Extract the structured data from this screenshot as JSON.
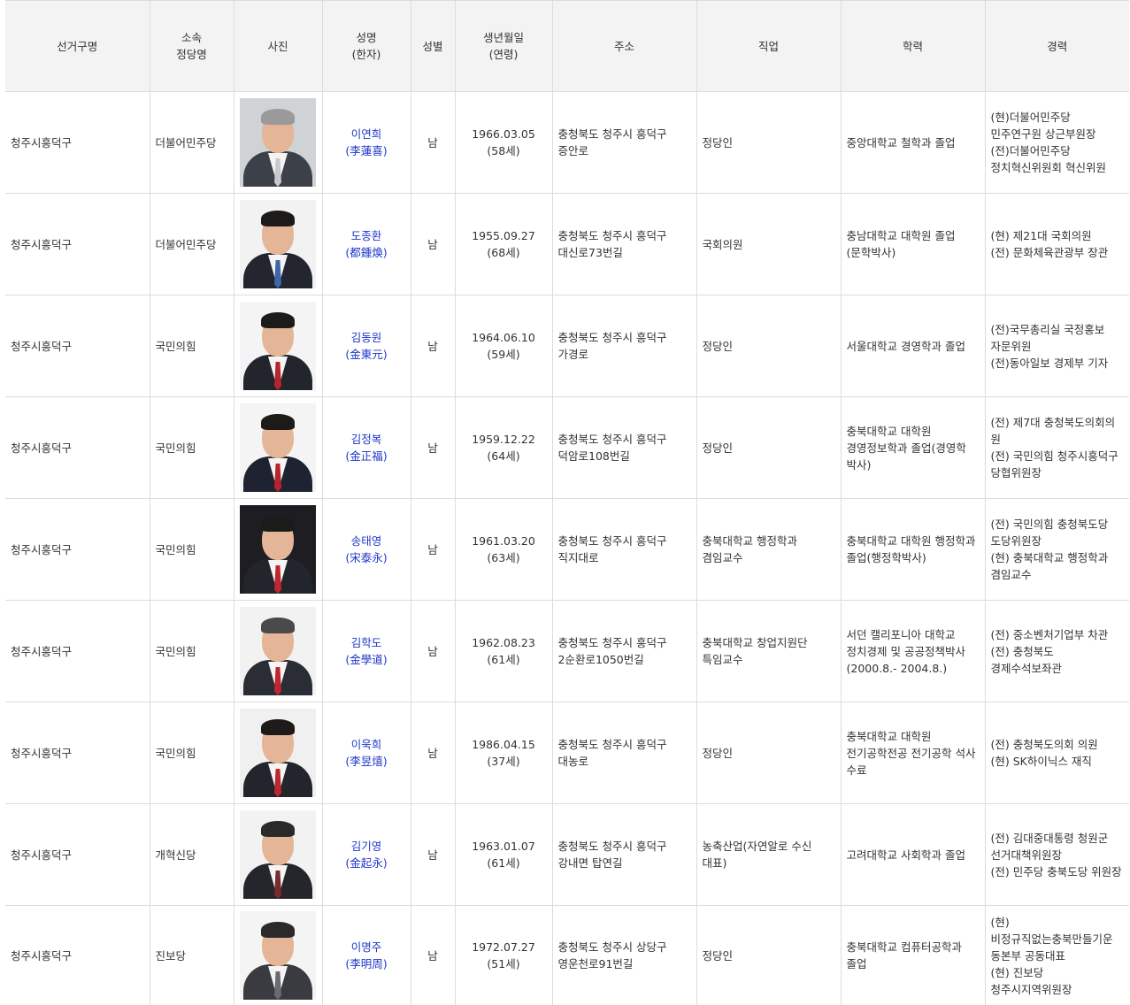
{
  "headers": [
    {
      "line1": "선거구명",
      "line2": ""
    },
    {
      "line1": "소속",
      "line2": "정당명"
    },
    {
      "line1": "사진",
      "line2": ""
    },
    {
      "line1": "성명",
      "line2": "(한자)"
    },
    {
      "line1": "성별",
      "line2": ""
    },
    {
      "line1": "생년월일",
      "line2": "(연령)"
    },
    {
      "line1": "주소",
      "line2": ""
    },
    {
      "line1": "직업",
      "line2": ""
    },
    {
      "line1": "학력",
      "line2": ""
    },
    {
      "line1": "경력",
      "line2": ""
    }
  ],
  "rows": [
    {
      "district": "청주시흥덕구",
      "party": "더불어민주당",
      "name": "이연희",
      "hanja": "(李蓮喜)",
      "gender": "남",
      "birth": "1966.03.05",
      "age": "(58세)",
      "address": "충청북도 청주시 흥덕구\n증안로",
      "job": "정당인",
      "education": "중앙대학교 철학과 졸업",
      "career": "(현)더불어민주당\n민주연구원 상근부원장\n(전)더불어민주당\n정치혁신위원회 혁신위원",
      "photo_bg": "#cfd3d6",
      "suit": "#3c4048",
      "tie": "#c7c9cc",
      "hair": "#9a9a9a"
    },
    {
      "district": "청주시흥덕구",
      "party": "더불어민주당",
      "name": "도종환",
      "hanja": "(都鍾煥)",
      "gender": "남",
      "birth": "1955.09.27",
      "age": "(68세)",
      "address": "충청북도 청주시 흥덕구\n대신로73번길",
      "job": "국회의원",
      "education": "충남대학교 대학원 졸업\n(문학박사)",
      "career": "(현) 제21대 국회의원\n(전) 문화체육관광부 장관",
      "photo_bg": "#f2f2f2",
      "suit": "#23262e",
      "tie": "#3f66a8",
      "hair": "#1c1b1a"
    },
    {
      "district": "청주시흥덕구",
      "party": "국민의힘",
      "name": "김동원",
      "hanja": "(金東元)",
      "gender": "남",
      "birth": "1964.06.10",
      "age": "(59세)",
      "address": "충청북도 청주시 흥덕구\n가경로",
      "job": "정당인",
      "education": "서울대학교 경영학과 졸업",
      "career": "(전)국무총리실 국정홍보\n자문위원\n(전)동아일보 경제부 기자",
      "photo_bg": "#f4f4f4",
      "suit": "#22252b",
      "tie": "#b8242c",
      "hair": "#1c1b1a"
    },
    {
      "district": "청주시흥덕구",
      "party": "국민의힘",
      "name": "김정복",
      "hanja": "(金正福)",
      "gender": "남",
      "birth": "1959.12.22",
      "age": "(64세)",
      "address": "충청북도 청주시 흥덕구\n덕암로108번길",
      "job": "정당인",
      "education": "충북대학교 대학원\n경영정보학과 졸업(경영학\n박사)",
      "career": "(전) 제7대 충청북도의회의원\n(전) 국민의힘 청주시흥덕구\n당협위원장",
      "photo_bg": "#f4f4f4",
      "suit": "#1f2230",
      "tie": "#b8242c",
      "hair": "#1c1b1a"
    },
    {
      "district": "청주시흥덕구",
      "party": "국민의힘",
      "name": "송태영",
      "hanja": "(宋泰永)",
      "gender": "남",
      "birth": "1961.03.20",
      "age": "(63세)",
      "address": "충청북도 청주시 흥덕구\n직지대로",
      "job": "충북대학교 행정학과\n겸임교수",
      "education": "충북대학교 대학원 행정학과\n졸업(행정학박사)",
      "career": "(전) 국민의힘 충청북도당\n도당위원장\n(현) 충북대학교 행정학과\n겸임교수",
      "photo_bg": "#1d1d22",
      "suit": "#22252b",
      "tie": "#c0262e",
      "hair": "#1c1b1a"
    },
    {
      "district": "청주시흥덕구",
      "party": "국민의힘",
      "name": "김학도",
      "hanja": "(金學道)",
      "gender": "남",
      "birth": "1962.08.23",
      "age": "(61세)",
      "address": "충청북도 청주시 흥덕구\n2순환로1050번길",
      "job": "충북대학교 창업지원단\n특임교수",
      "education": "서던 캘리포니아 대학교\n정치경제 및 공공정책박사\n(2000.8.- 2004.8.)",
      "career": "(전) 중소벤처기업부 차관\n(전) 충청북도\n경제수석보좌관",
      "photo_bg": "#f2f2f2",
      "suit": "#2a2d35",
      "tie": "#c0262e",
      "hair": "#4a4a4a"
    },
    {
      "district": "청주시흥덕구",
      "party": "국민의힘",
      "name": "이욱희",
      "hanja": "(李昱熺)",
      "gender": "남",
      "birth": "1986.04.15",
      "age": "(37세)",
      "address": "충청북도 청주시 흥덕구\n대농로",
      "job": "정당인",
      "education": "충북대학교 대학원\n전기공학전공 전기공학 석사\n수료",
      "career": "(전) 충청북도의회 의원\n(현) SK하이닉스 재직",
      "photo_bg": "#f0f0f0",
      "suit": "#22252b",
      "tie": "#c0262e",
      "hair": "#1c1b1a"
    },
    {
      "district": "청주시흥덕구",
      "party": "개혁신당",
      "name": "김기영",
      "hanja": "(金起永)",
      "gender": "남",
      "birth": "1963.01.07",
      "age": "(61세)",
      "address": "충청북도 청주시 흥덕구\n강내면 탑연길",
      "job": "농축산업(자연알로 수신\n대표)",
      "education": "고려대학교 사회학과 졸업",
      "career": "(전) 김대중대통령 청원군\n선거대책위원장\n(전) 민주당 충북도당 위원장",
      "photo_bg": "#f2f2f2",
      "suit": "#25262b",
      "tie": "#7a2a2e",
      "hair": "#2a2a2a"
    },
    {
      "district": "청주시흥덕구",
      "party": "진보당",
      "name": "이명주",
      "hanja": "(李明周)",
      "gender": "남",
      "birth": "1972.07.27",
      "age": "(51세)",
      "address": "충청북도 청주시 상당구\n영운천로91번길",
      "job": "정당인",
      "education": "충북대학교 컴퓨터공학과\n졸업",
      "career": "(현)\n비정규직없는충북만들기운\n동본부 공동대표\n(현) 진보당\n청주시지역위원장",
      "photo_bg": "#f4f4f4",
      "suit": "#3a3b40",
      "tie": "#6a6b70",
      "hair": "#2a2a2a"
    }
  ]
}
